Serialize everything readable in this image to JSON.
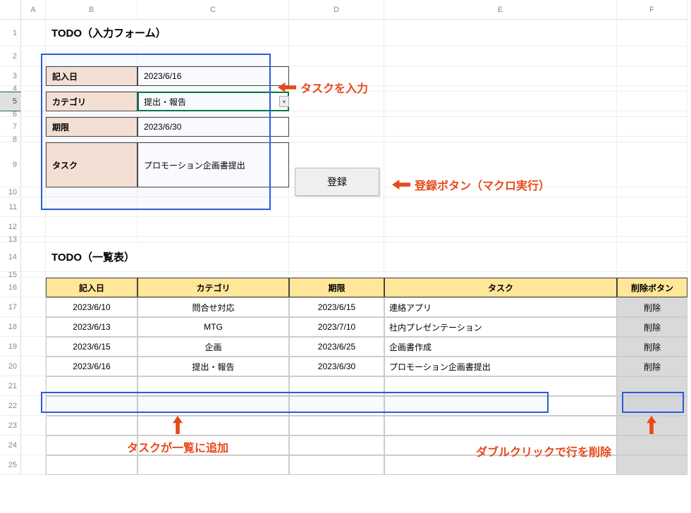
{
  "columns": [
    "A",
    "B",
    "C",
    "D",
    "E",
    "F"
  ],
  "rowsVisible": 25,
  "formTitle": "TODO（入力フォーム）",
  "listTitle": "TODO（一覧表）",
  "form": {
    "dateLabel": "記入日",
    "dateValue": "2023/6/16",
    "catLabel": "カテゴリ",
    "catValue": "提出・報告",
    "dueLabel": "期限",
    "dueValue": "2023/6/30",
    "taskLabel": "タスク",
    "taskValue": "プロモーション企画書提出"
  },
  "registerBtn": "登録",
  "listHeader": [
    "記入日",
    "カテゴリ",
    "期限",
    "タスク",
    "削除ボタン"
  ],
  "deleteLabel": "削除",
  "rows": [
    {
      "date": "2023/6/10",
      "cat": "問合せ対応",
      "due": "2023/6/15",
      "task": "連絡アプリ"
    },
    {
      "date": "2023/6/13",
      "cat": "MTG",
      "due": "2023/7/10",
      "task": "社内プレゼンテーション"
    },
    {
      "date": "2023/6/15",
      "cat": "企画",
      "due": "2023/6/25",
      "task": "企画書作成"
    },
    {
      "date": "2023/6/16",
      "cat": "提出・報告",
      "due": "2023/6/30",
      "task": "プロモーション企画書提出"
    }
  ],
  "callouts": {
    "inputTask": "タスクを入力",
    "registerExec": "登録ボタン（マクロ実行）",
    "addedToList": "タスクが一覧に追加",
    "dblclickDelete": "ダブルクリックで行を削除"
  }
}
